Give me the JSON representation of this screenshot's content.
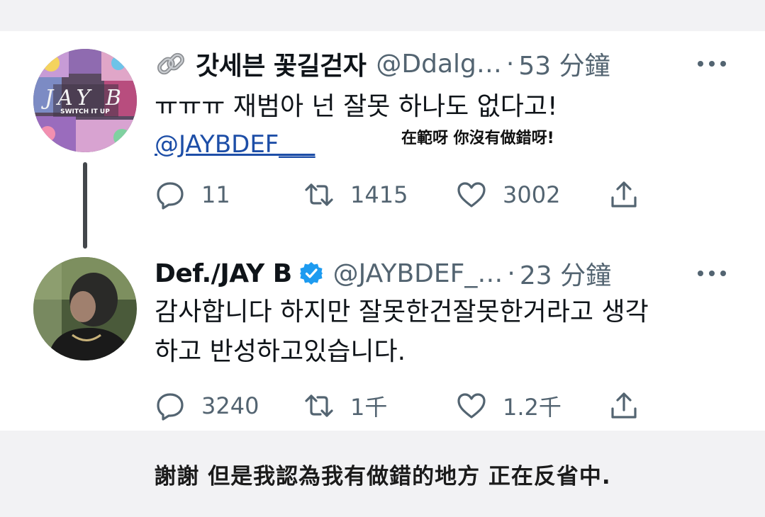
{
  "tweets": [
    {
      "display_name": "갓세븐 꽃길걷자",
      "handle": "@Ddalg…",
      "separator": "·",
      "time": "53 分鐘",
      "text_lines": [
        "ㅠㅠㅠ 재범아 넌 잘못 하나도 없다고!"
      ],
      "mention": "@JAYBDEF___",
      "caption": "在範呀 你沒有做錯呀!",
      "reply_count": "11",
      "retweet_count": "1415",
      "like_count": "3002",
      "avatar_text": "JAY B",
      "avatar_subtext": "SWITCH IT UP",
      "name_icon": "link-icon",
      "colors": {
        "mention": "#1d4ea7"
      }
    },
    {
      "display_name": "Def./JAY B",
      "handle": "@JAYBDEF_…",
      "separator": "·",
      "time": "23 分鐘",
      "text_lines": [
        "감사합니다 하지만 잘못한건잘못한거라고 생각",
        "하고 반성하고있습니다."
      ],
      "reply_count": "3240",
      "retweet_count": "1千",
      "like_count": "1.2千",
      "verified": true,
      "colors": {
        "verified": "#1d9bf0"
      }
    }
  ],
  "footer_caption": "謝謝 但是我認為我有做錯的地方 正在反省中.",
  "colors": {
    "background": "#f2f2f4",
    "card": "#ffffff",
    "secondary_text": "#536471",
    "thread_line": "#43474b"
  }
}
